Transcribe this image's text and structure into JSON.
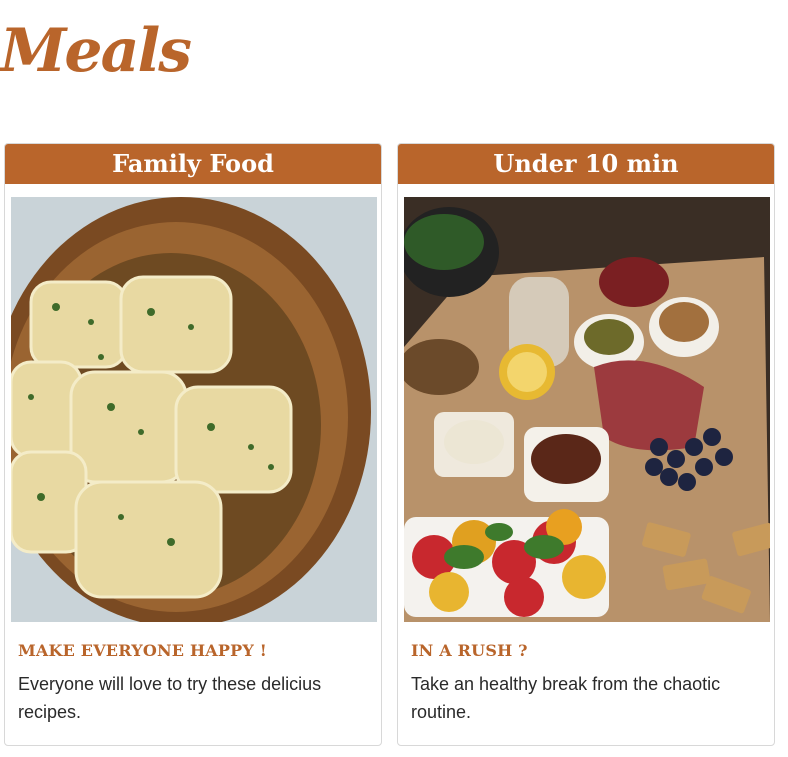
{
  "brand": {
    "title": "Meals",
    "color": "#b9652b"
  },
  "cards": [
    {
      "header": "Family Food",
      "image_subject": "ravioli-in-wooden-bowl",
      "subtitle": "Make everyone happy !",
      "text": "Everyone will love to try these delicius recipes."
    },
    {
      "header": "Under 10 min",
      "image_subject": "charcuterie-board",
      "subtitle": "In a rush ?",
      "text": "Take an healthy break from the chaotic routine."
    }
  ]
}
